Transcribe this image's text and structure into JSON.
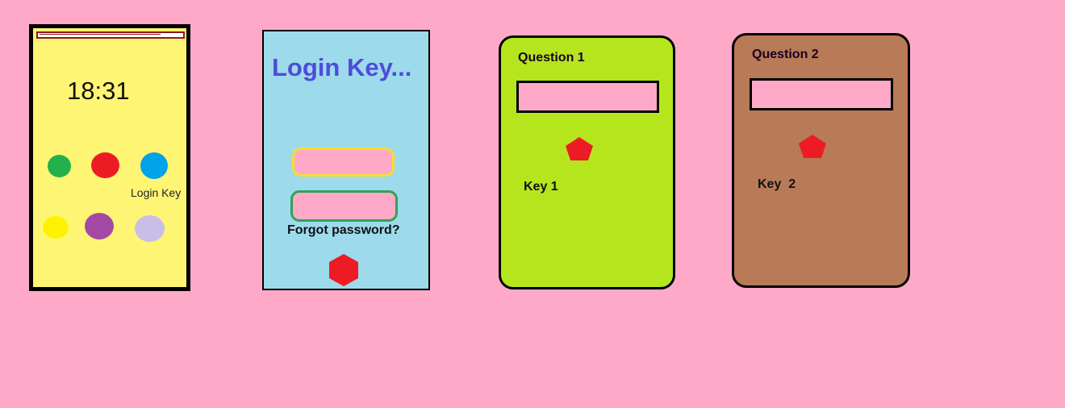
{
  "screens": {
    "home": {
      "clock": "18:31",
      "apps": [
        {
          "icon": "green-app-icon",
          "color": "#22B14C"
        },
        {
          "icon": "red-app-icon",
          "color": "#ED1C24"
        },
        {
          "icon": "blue-app-icon",
          "color": "#00A2E8",
          "label": "Login Key"
        },
        {
          "icon": "yellow-app-icon",
          "color": "#FFF200"
        },
        {
          "icon": "purple-app-icon",
          "color": "#A349A4"
        },
        {
          "icon": "lavender-app-icon",
          "color": "#C8BFE7"
        }
      ],
      "background": "#FFF575"
    },
    "login": {
      "title": "Login Key...",
      "forgot_password": "Forgot password?",
      "background": "#9DDAEC",
      "title_color": "#4E4CD8"
    },
    "question1": {
      "title": "Question 1",
      "key_label": "Key 1",
      "background": "#B5E61D"
    },
    "question2": {
      "title": "Question 2",
      "key_label": "Key  2",
      "background": "#B97A57"
    }
  },
  "colors": {
    "page_background": "#FFA9C9",
    "button_red": "#ED1C24"
  }
}
